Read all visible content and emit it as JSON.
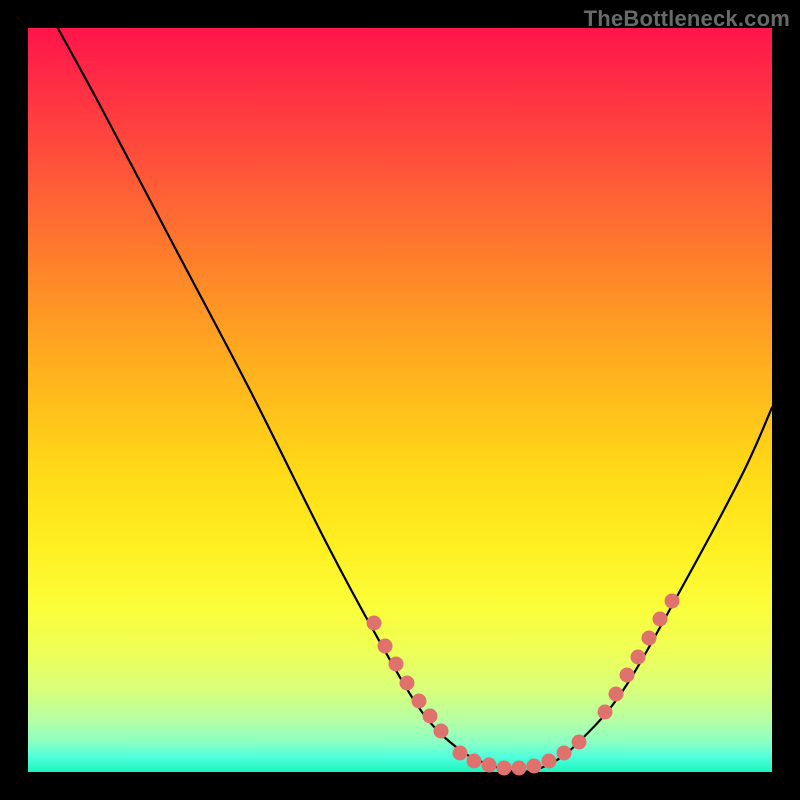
{
  "watermark": "TheBottleneck.com",
  "chart_data": {
    "type": "line",
    "title": "",
    "xlabel": "",
    "ylabel": "",
    "xlim": [
      0,
      100
    ],
    "ylim": [
      0,
      100
    ],
    "grid": false,
    "background": "gradient-red-to-green",
    "series": [
      {
        "name": "curve",
        "x": [
          4,
          10,
          20,
          30,
          40,
          47,
          53,
          58,
          62,
          66,
          70,
          74,
          80,
          88,
          96,
          100
        ],
        "y": [
          100,
          89,
          70,
          51,
          31,
          18,
          8,
          3,
          1,
          0,
          1,
          4,
          11,
          25,
          40,
          49
        ]
      },
      {
        "name": "dots-left",
        "x": [
          46.5,
          48.0,
          49.5,
          51.0,
          52.5,
          54.0,
          55.5
        ],
        "y": [
          20.0,
          17.0,
          14.5,
          12.0,
          9.5,
          7.5,
          5.5
        ]
      },
      {
        "name": "dots-bottom",
        "x": [
          58.0,
          60.0,
          62.0,
          64.0,
          66.0,
          68.0,
          70.0,
          72.0,
          74.0
        ],
        "y": [
          2.5,
          1.5,
          1.0,
          0.5,
          0.5,
          0.8,
          1.5,
          2.5,
          4.0
        ]
      },
      {
        "name": "dots-right",
        "x": [
          77.5,
          79.0,
          80.5,
          82.0,
          83.5,
          85.0,
          86.5
        ],
        "y": [
          8.0,
          10.5,
          13.0,
          15.5,
          18.0,
          20.5,
          23.0
        ]
      }
    ]
  }
}
